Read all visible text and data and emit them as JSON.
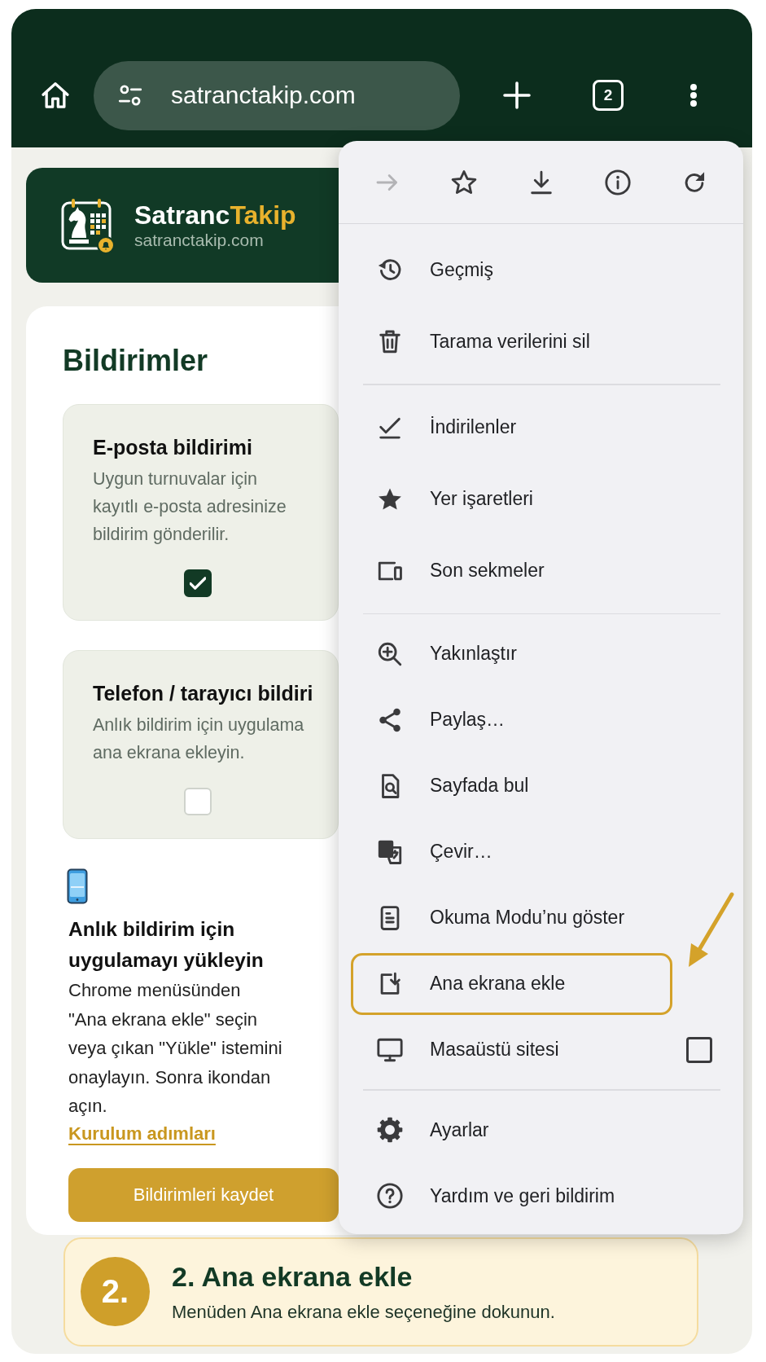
{
  "browser": {
    "url": "satranctakip.com",
    "tab_count": "2"
  },
  "site_header": {
    "brand_name": "Satranc",
    "brand_accent": "Takip",
    "domain": "satranctakip.com"
  },
  "panel": {
    "title": "Bildirimler",
    "options": [
      {
        "title": "E-posta bildirimi",
        "description": "Uygun turnuvalar için\nkayıtlı e-posta adresinize\nbildirim gönderilir.",
        "checked": true
      },
      {
        "title": "Telefon / tarayıcı bildiri",
        "description": "Anlık bildirim için uygulama\nana ekrana ekleyin.",
        "checked": false
      }
    ],
    "install": {
      "title": "Anlık bildirim için uygulamayı yükleyin",
      "body": "Chrome menüsünden\n\"Ana ekrana ekle\" seçin\nveya çıkan \"Yükle\" istemini\nonaylayın. Sonra ikondan\naçın.",
      "link": "Kurulum adımları"
    },
    "save_button": "Bildirimleri kaydet"
  },
  "menu": {
    "toolbar": [
      {
        "disabled": true
      },
      {
        "disabled": false
      },
      {
        "disabled": false
      },
      {
        "disabled": false
      },
      {
        "disabled": false
      }
    ],
    "groups": [
      {
        "items": [
          {
            "label": "Geçmiş",
            "kind": "action",
            "highlighted": false
          },
          {
            "label": "Tarama verilerini sil",
            "kind": "action",
            "highlighted": false
          }
        ]
      },
      {
        "items": [
          {
            "label": "İndirilenler",
            "kind": "action",
            "highlighted": false
          },
          {
            "label": "Yer işaretleri",
            "kind": "action",
            "highlighted": false
          },
          {
            "label": "Son sekmeler",
            "kind": "action",
            "highlighted": false
          }
        ]
      },
      {
        "items": [
          {
            "label": "Yakınlaştır",
            "kind": "action",
            "highlighted": false
          },
          {
            "label": "Paylaş…",
            "kind": "action",
            "highlighted": false
          },
          {
            "label": "Sayfada bul",
            "kind": "action",
            "highlighted": false
          },
          {
            "label": "Çevir…",
            "kind": "action",
            "highlighted": false
          },
          {
            "label": "Okuma Modu’nu göster",
            "kind": "action",
            "highlighted": false
          },
          {
            "label": "Ana ekrana ekle",
            "kind": "action",
            "highlighted": true
          },
          {
            "label": "Masaüstü sitesi",
            "kind": "toggle",
            "checked": false,
            "highlighted": false
          }
        ]
      },
      {
        "items": [
          {
            "label": "Ayarlar",
            "kind": "action",
            "highlighted": false
          },
          {
            "label": "Yardım ve geri bildirim",
            "kind": "action",
            "highlighted": false
          }
        ]
      }
    ]
  },
  "step": {
    "number": "2.",
    "title": "2. Ana ekrana ekle",
    "text": "Menüden Ana ekrana ekle seçeneğine dokunun."
  }
}
